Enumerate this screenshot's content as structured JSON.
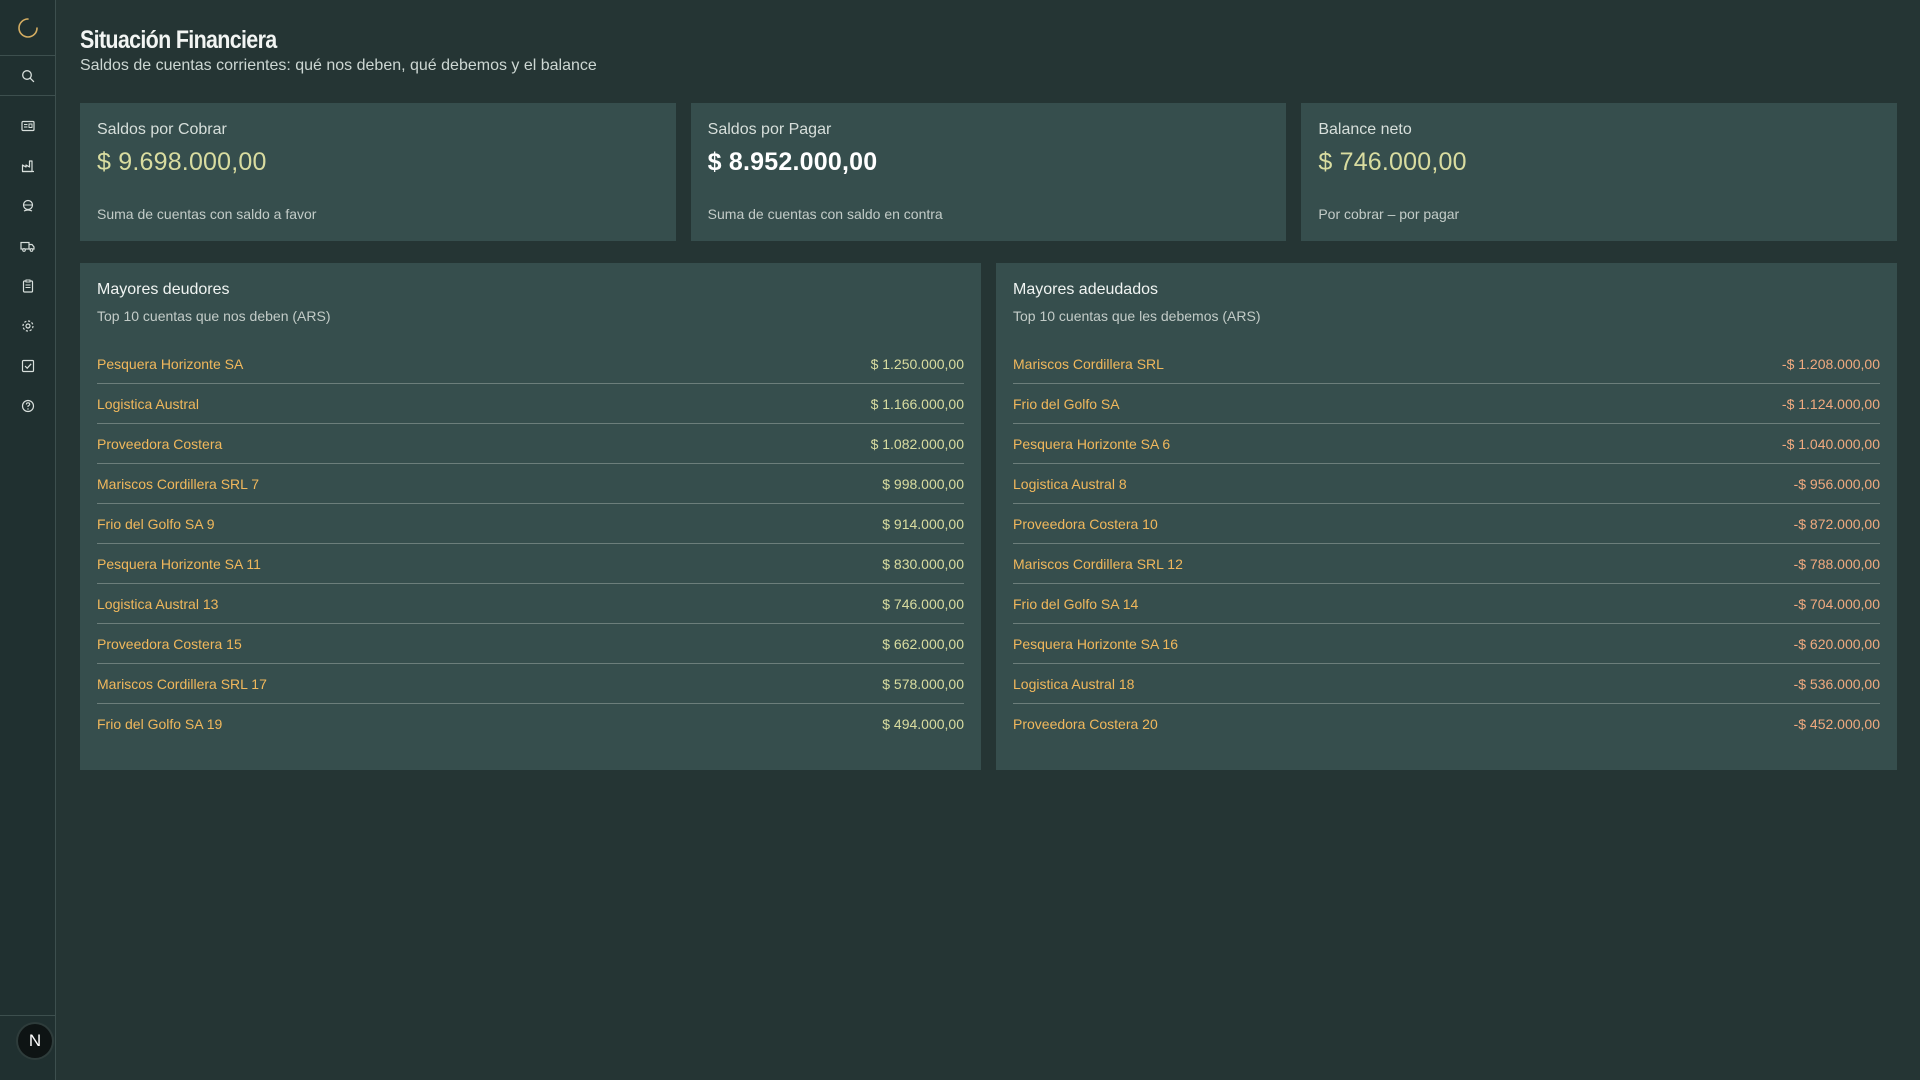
{
  "header": {
    "title": "Situación Financiera",
    "subtitle": "Saldos de cuentas corrientes: qué nos deben, qué debemos y el balance"
  },
  "sidebar": {
    "logo_icon": "loading-arc-icon",
    "search_icon": "search-icon",
    "items": [
      {
        "icon": "id-card-icon"
      },
      {
        "icon": "factory-icon"
      },
      {
        "icon": "globe-hand-icon"
      },
      {
        "icon": "truck-icon"
      },
      {
        "icon": "clipboard-icon"
      },
      {
        "icon": "gear-icon"
      },
      {
        "icon": "checkbox-icon"
      },
      {
        "icon": "help-icon"
      }
    ],
    "avatar_letter": "N"
  },
  "kpis": [
    {
      "label": "Saldos por Cobrar",
      "value": "$ 9.698.000,00",
      "description": "Suma de cuentas con saldo a favor"
    },
    {
      "label": "Saldos por Pagar",
      "value": "$ 8.952.000,00",
      "description": "Suma de cuentas con saldo en contra"
    },
    {
      "label": "Balance neto",
      "value": "$ 746.000,00",
      "description": "Por cobrar – por pagar"
    }
  ],
  "deudores": {
    "title": "Mayores deudores",
    "subtitle": "Top 10 cuentas que nos deben (ARS)",
    "rows": [
      {
        "name": "Pesquera Horizonte SA",
        "amount": "$ 1.250.000,00"
      },
      {
        "name": "Logistica Austral",
        "amount": "$ 1.166.000,00"
      },
      {
        "name": "Proveedora Costera",
        "amount": "$ 1.082.000,00"
      },
      {
        "name": "Mariscos Cordillera SRL 7",
        "amount": "$ 998.000,00"
      },
      {
        "name": "Frio del Golfo SA 9",
        "amount": "$ 914.000,00"
      },
      {
        "name": "Pesquera Horizonte SA 11",
        "amount": "$ 830.000,00"
      },
      {
        "name": "Logistica Austral 13",
        "amount": "$ 746.000,00"
      },
      {
        "name": "Proveedora Costera 15",
        "amount": "$ 662.000,00"
      },
      {
        "name": "Mariscos Cordillera SRL 17",
        "amount": "$ 578.000,00"
      },
      {
        "name": "Frio del Golfo SA 19",
        "amount": "$ 494.000,00"
      }
    ]
  },
  "adeudados": {
    "title": "Mayores adeudados",
    "subtitle": "Top 10 cuentas que les debemos (ARS)",
    "rows": [
      {
        "name": "Mariscos Cordillera SRL",
        "amount": "-$ 1.208.000,00"
      },
      {
        "name": "Frio del Golfo SA",
        "amount": "-$ 1.124.000,00"
      },
      {
        "name": "Pesquera Horizonte SA 6",
        "amount": "-$ 1.040.000,00"
      },
      {
        "name": "Logistica Austral 8",
        "amount": "-$ 956.000,00"
      },
      {
        "name": "Proveedora Costera 10",
        "amount": "-$ 872.000,00"
      },
      {
        "name": "Mariscos Cordillera SRL 12",
        "amount": "-$ 788.000,00"
      },
      {
        "name": "Frio del Golfo SA 14",
        "amount": "-$ 704.000,00"
      },
      {
        "name": "Pesquera Horizonte SA 16",
        "amount": "-$ 620.000,00"
      },
      {
        "name": "Logistica Austral 18",
        "amount": "-$ 536.000,00"
      },
      {
        "name": "Proveedora Costera 20",
        "amount": "-$ 452.000,00"
      }
    ]
  },
  "colors": {
    "background": "#253534",
    "card": "#364e4d",
    "link": "#f1b85c",
    "positive": "#d9dca0",
    "negative": "#f1aa7f"
  }
}
